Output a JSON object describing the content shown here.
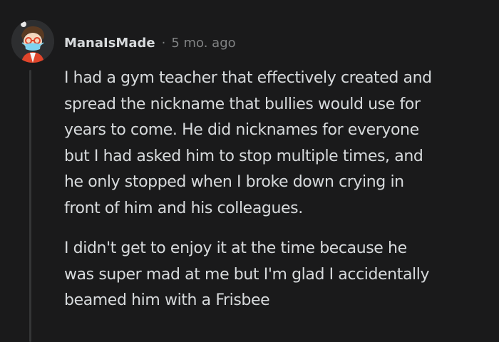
{
  "comment": {
    "author": "ManaIsMade",
    "separator": "·",
    "time_ago": "5 mo. ago",
    "paragraphs": [
      "I had a gym teacher that effectively created and\nspread the nickname that bullies would use for\nyears to come. He did nicknames for everyone\nbut I had asked him to stop multiple times, and\nhe only stopped when I broke down crying in\nfront of him and his colleagues.",
      "I didn't get to enjoy it at the time because he\nwas super mad at me but I'm glad I accidentally\nbeamed him with a Frisbee"
    ]
  },
  "colors": {
    "background": "#1a1a1b",
    "text": "#d7dadc",
    "meta_text": "#818384",
    "thread_line": "#343536"
  },
  "icons": {
    "avatar": "snoo-avatar-with-glasses-and-mask"
  }
}
